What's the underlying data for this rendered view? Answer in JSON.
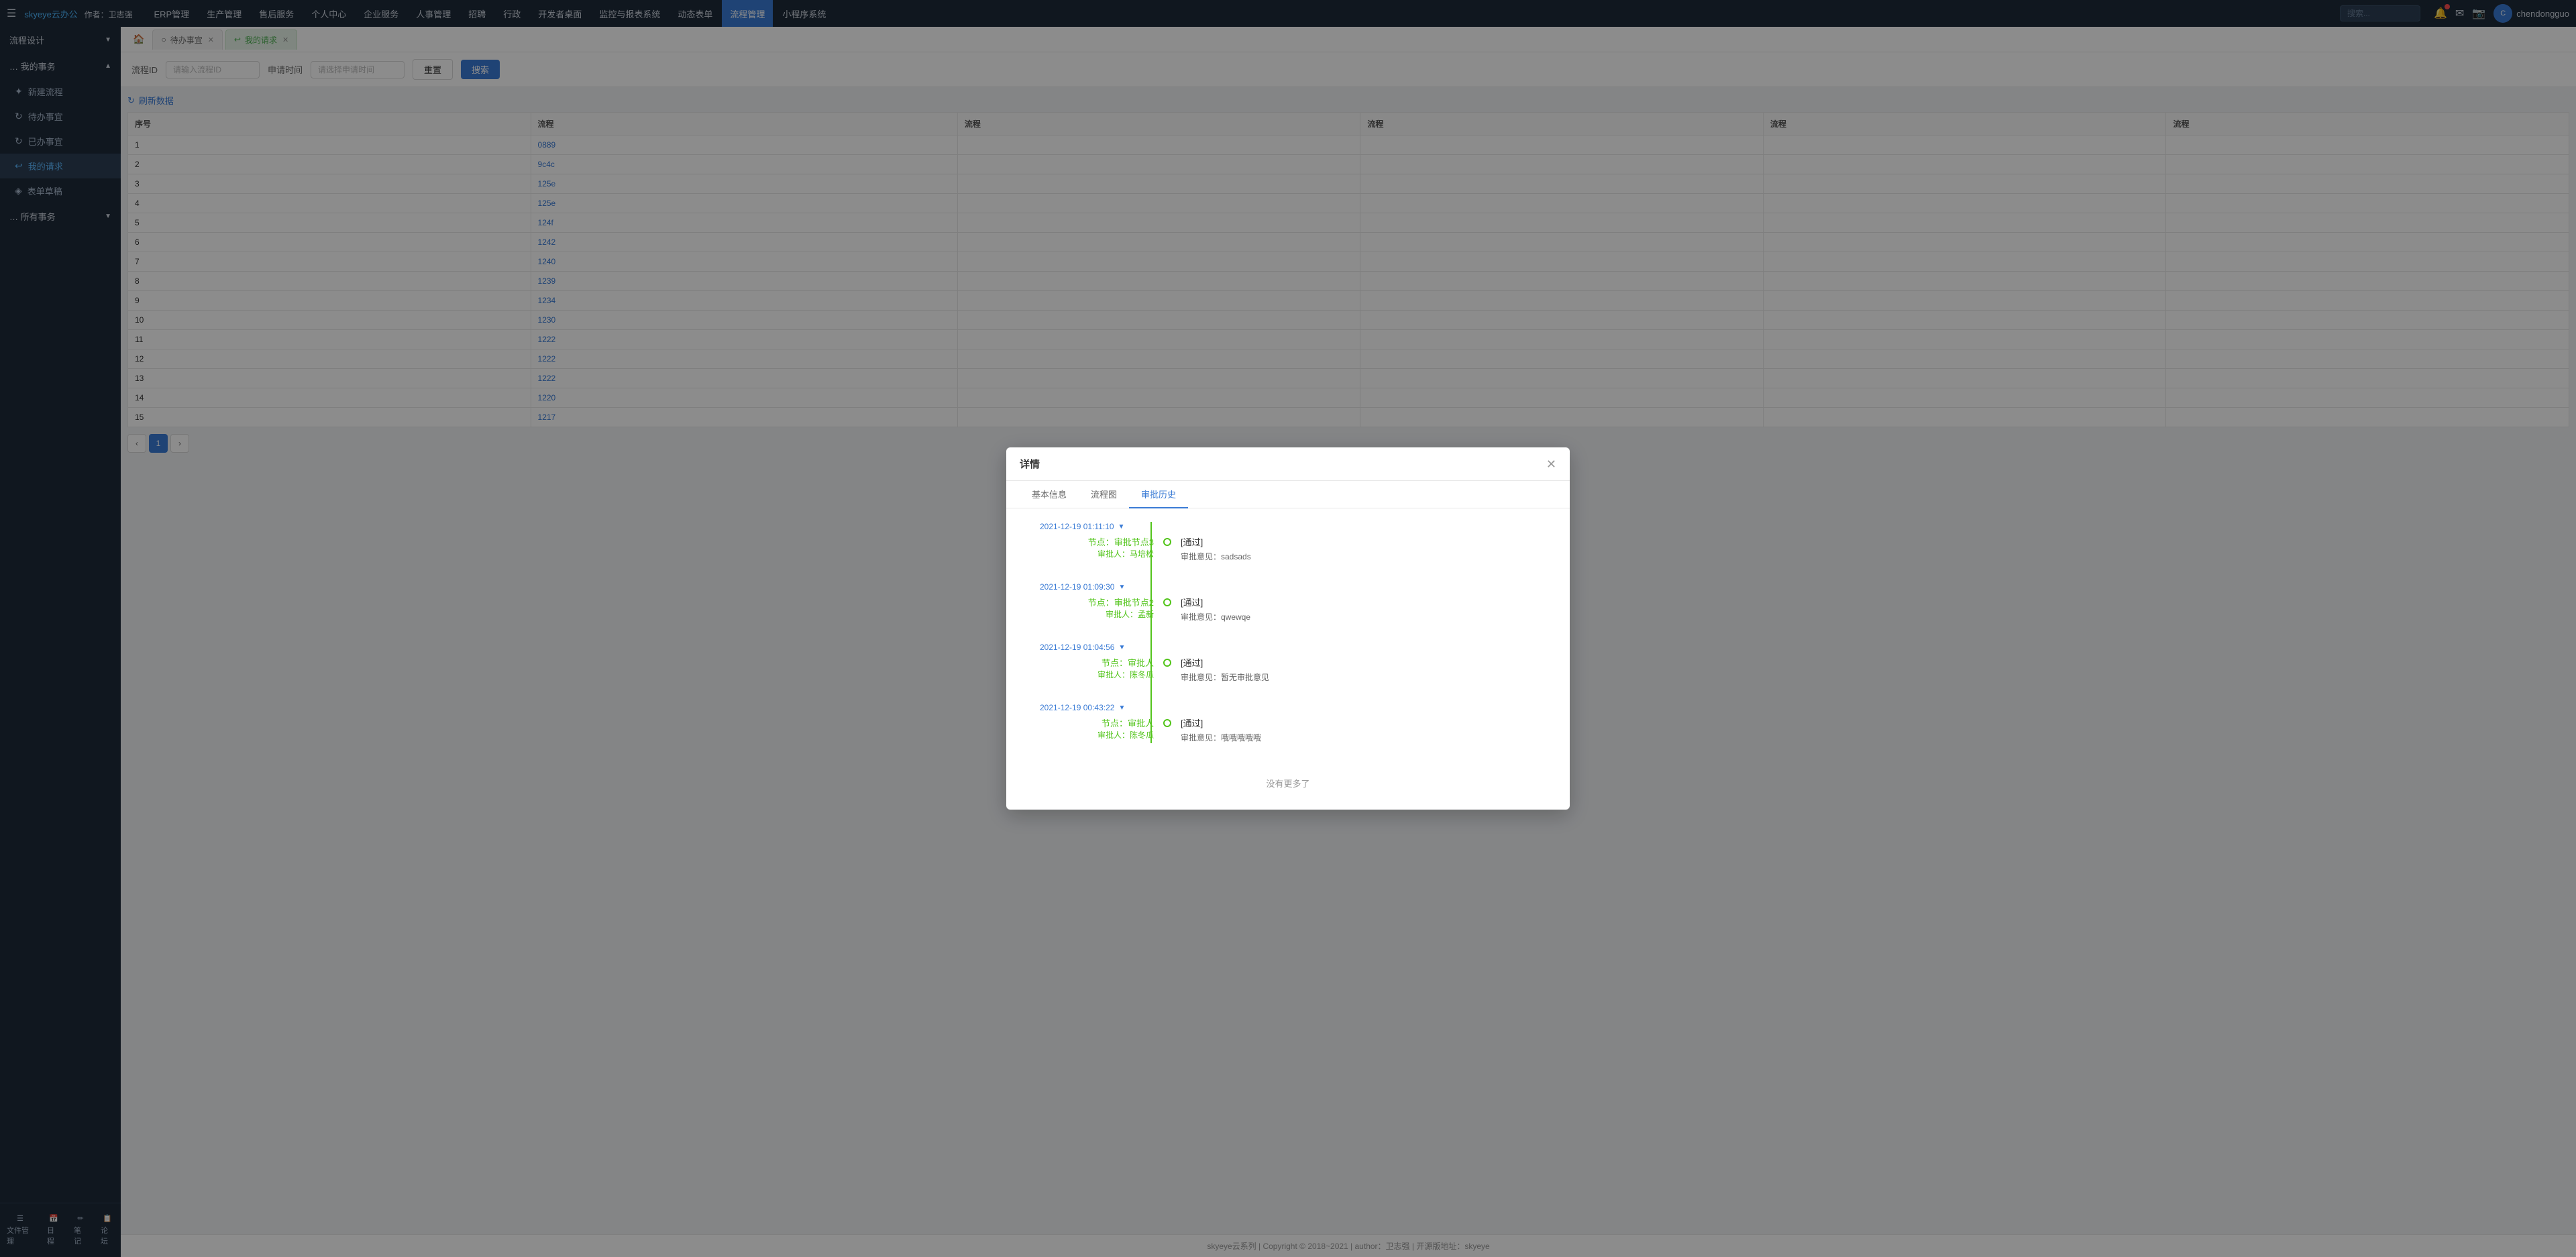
{
  "brand": {
    "logo": "skyeye云办公",
    "author": "作者：卫志强"
  },
  "topnav": {
    "menu_icon": "☰",
    "items": [
      {
        "label": "ERP管理",
        "active": false
      },
      {
        "label": "生产管理",
        "active": false
      },
      {
        "label": "售后服务",
        "active": false
      },
      {
        "label": "个人中心",
        "active": false
      },
      {
        "label": "企业服务",
        "active": false
      },
      {
        "label": "人事管理",
        "active": false
      },
      {
        "label": "招聘",
        "active": false
      },
      {
        "label": "行政",
        "active": false
      },
      {
        "label": "开发者桌面",
        "active": false
      },
      {
        "label": "监控与报表系统",
        "active": false
      },
      {
        "label": "动态表单",
        "active": false
      },
      {
        "label": "流程管理",
        "active": true
      },
      {
        "label": "小程序系统",
        "active": false
      }
    ],
    "search_placeholder": "搜索...",
    "user": {
      "name": "chendongguo",
      "avatar_text": "C"
    }
  },
  "sidebar": {
    "flow_design": {
      "label": "流程设计",
      "arrow": "▲"
    },
    "my_affairs": {
      "label": "… 我的事务",
      "arrow": "▲"
    },
    "items": [
      {
        "label": "新建流程",
        "icon": "○",
        "active": false
      },
      {
        "label": "待办事宜",
        "icon": "○",
        "active": false
      },
      {
        "label": "已办事宜",
        "icon": "○",
        "active": false
      },
      {
        "label": "我的请求",
        "icon": "○",
        "active": true
      },
      {
        "label": "表单草稿",
        "icon": "○",
        "active": false
      }
    ],
    "all_affairs": {
      "label": "… 所有事务",
      "arrow": "▼"
    },
    "bottom": [
      {
        "label": "文件管理",
        "icon": "☰"
      },
      {
        "label": "日程",
        "icon": "📅"
      },
      {
        "label": "笔记",
        "icon": "✏"
      },
      {
        "label": "论坛",
        "icon": "📅"
      }
    ]
  },
  "tabs": [
    {
      "label": "待办事宜",
      "icon": "○",
      "active": false,
      "closable": true
    },
    {
      "label": "我的请求",
      "icon": "↩",
      "active": true,
      "closable": true
    }
  ],
  "filter": {
    "flow_id_label": "流程ID",
    "flow_id_placeholder": "请输入流程ID",
    "apply_time_label": "申请时间",
    "apply_time_placeholder": "请选择申请时间",
    "reset_label": "重置",
    "search_label": "搜索"
  },
  "table": {
    "refresh_label": "刷新数据",
    "columns": [
      "序号",
      "流程",
      "流程",
      "流程",
      "流程",
      "流程"
    ],
    "rows": [
      {
        "no": 1,
        "code": "0889"
      },
      {
        "no": 2,
        "code": "9c4c"
      },
      {
        "no": 3,
        "code": "125e"
      },
      {
        "no": 4,
        "code": "125e"
      },
      {
        "no": 5,
        "code": "124f"
      },
      {
        "no": 6,
        "code": "1242"
      },
      {
        "no": 7,
        "code": "1240"
      },
      {
        "no": 8,
        "code": "1239"
      },
      {
        "no": 9,
        "code": "1234"
      },
      {
        "no": 10,
        "code": "1230"
      },
      {
        "no": 11,
        "code": "1222"
      },
      {
        "no": 12,
        "code": "1222"
      },
      {
        "no": 13,
        "code": "1222"
      },
      {
        "no": 14,
        "code": "1220"
      },
      {
        "no": 15,
        "code": "1217"
      }
    ],
    "page": 1,
    "prev_label": "‹",
    "next_label": "›"
  },
  "modal": {
    "title": "详情",
    "close_label": "✕",
    "tabs": [
      {
        "label": "基本信息",
        "active": false
      },
      {
        "label": "流程图",
        "active": false
      },
      {
        "label": "审批历史",
        "active": true
      }
    ],
    "timeline": [
      {
        "time": "2021-12-19 01:11:10",
        "node_name": "节点：审批节点3",
        "approver": "审批人：马培松",
        "status": "[通过]",
        "comment_label": "审批意见：",
        "comment": "sadsads"
      },
      {
        "time": "2021-12-19 01:09:30",
        "node_name": "节点：审批节点2",
        "approver": "审批人：孟新",
        "status": "[通过]",
        "comment_label": "审批意见：",
        "comment": "qwewqe"
      },
      {
        "time": "2021-12-19 01:04:56",
        "node_name": "节点：审批人",
        "approver": "审批人：陈冬瓜",
        "status": "[通过]",
        "comment_label": "审批意见：",
        "comment": "暂无审批意见"
      },
      {
        "time": "2021-12-19 00:43:22",
        "node_name": "节点：审批人",
        "approver": "审批人：陈冬瓜",
        "status": "[通过]",
        "comment_label": "审批意见：",
        "comment": "哦哦哦哦哦"
      }
    ],
    "no_more_label": "没有更多了"
  },
  "footer": {
    "text": "skyeye云系列 | Copyright © 2018~2021 | author：卫志强 | 开源版地址：skyeye"
  }
}
